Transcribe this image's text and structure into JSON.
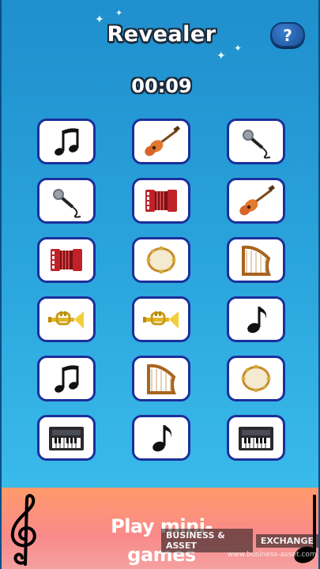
{
  "game": {
    "title": "Revealer",
    "timer": "00:09",
    "help_label": "?"
  },
  "board": {
    "rows": 6,
    "cols": 3,
    "tiles": [
      {
        "icon": "music-notes-icon"
      },
      {
        "icon": "guitar-icon"
      },
      {
        "icon": "microphone-icon"
      },
      {
        "icon": "microphone-icon"
      },
      {
        "icon": "accordion-icon"
      },
      {
        "icon": "guitar-icon"
      },
      {
        "icon": "accordion-icon"
      },
      {
        "icon": "tambourine-icon"
      },
      {
        "icon": "harp-icon"
      },
      {
        "icon": "trumpet-icon"
      },
      {
        "icon": "trumpet-icon"
      },
      {
        "icon": "music-note-icon"
      },
      {
        "icon": "music-notes-icon"
      },
      {
        "icon": "harp-icon"
      },
      {
        "icon": "tambourine-icon"
      },
      {
        "icon": "keyboard-icon"
      },
      {
        "icon": "music-note-icon"
      },
      {
        "icon": "keyboard-icon"
      }
    ]
  },
  "banner": {
    "label": "Play mini-games"
  },
  "watermark": {
    "brand_left": "BUSINESS & ASSET",
    "brand_right": "EXCHANGE",
    "url": "www.business-asset.com"
  },
  "colors": {
    "background_top": "#1f8fcd",
    "background_bottom": "#3fc2ee",
    "tile_border": "#1b2f9a",
    "banner": "#ff9a6a"
  }
}
